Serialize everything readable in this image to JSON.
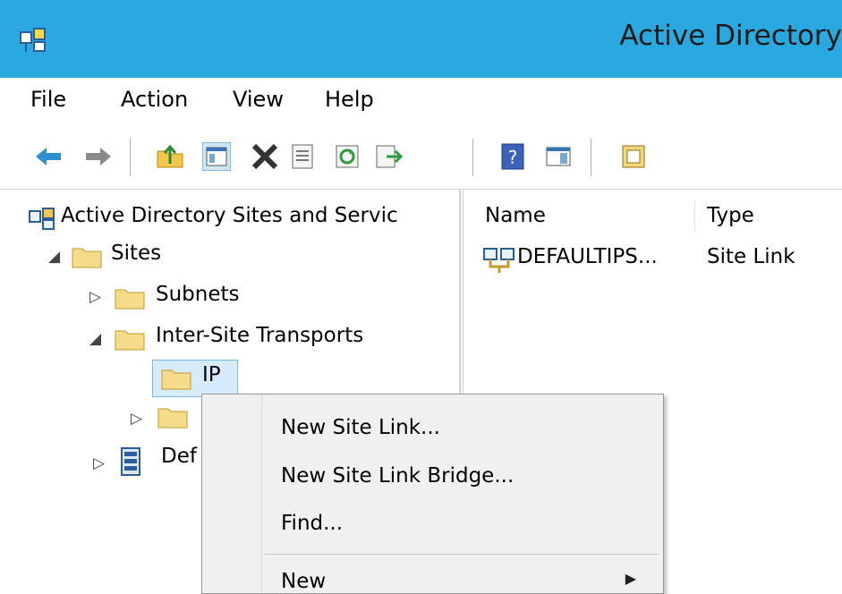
{
  "window": {
    "title": "Active Directory"
  },
  "menu": [
    "File",
    "Action",
    "View",
    "Help"
  ],
  "toolbar_icons": [
    "back-icon",
    "forward-icon",
    "up-folder-icon",
    "show-hide-tree-icon",
    "delete-icon",
    "properties-icon",
    "refresh-icon",
    "export-list-icon",
    "help-icon",
    "action-pane-icon",
    "new-window-icon"
  ],
  "tree": {
    "root": "Active Directory Sites and Servic",
    "sites": "Sites",
    "subnets": "Subnets",
    "inter_site": "Inter-Site Transports",
    "ip": "IP",
    "partial": "Def"
  },
  "list": {
    "columns": [
      "Name",
      "Type"
    ],
    "rows": [
      {
        "name": "DEFAULTIPS...",
        "type": "Site Link"
      }
    ]
  },
  "context_menu": {
    "items": [
      "New Site Link...",
      "New Site Link Bridge...",
      "Find...",
      "New"
    ]
  },
  "colors": {
    "titlebar": "#29a9e0",
    "selection": "#d6ebfb",
    "menu_bg": "#f0f0f0"
  }
}
